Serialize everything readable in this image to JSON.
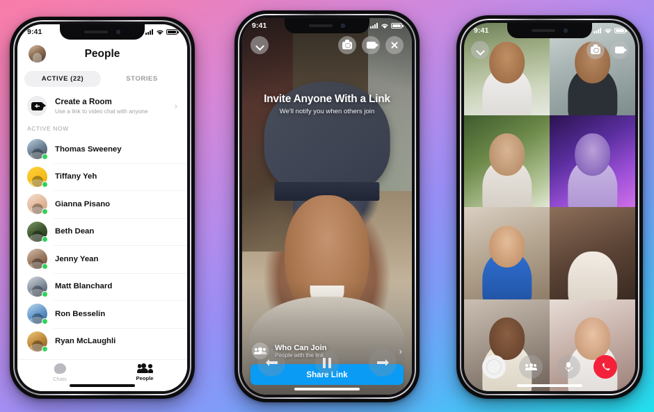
{
  "background": {
    "gradient_colors": [
      "#f97ca8",
      "#d987d6",
      "#9a8ff6",
      "#55b6f8",
      "#22e0ee"
    ]
  },
  "accent": {
    "messenger_blue": "#0a9bf5",
    "active_green": "#31d158",
    "end_call_red": "#f3223a"
  },
  "phone1": {
    "status": {
      "time": "9:41",
      "signal_icon": "cellular-bars-icon",
      "wifi_icon": "wifi-icon",
      "battery_icon": "battery-icon"
    },
    "header": {
      "title": "People",
      "avatar_icon": "profile-avatar"
    },
    "tabs": [
      {
        "label": "ACTIVE (22)",
        "active": true
      },
      {
        "label": "STORIES",
        "active": false
      }
    ],
    "create_room": {
      "icon": "video-room-icon",
      "title": "Create a Room",
      "subtitle": "Use a link to video chat with anyone",
      "chevron": "›"
    },
    "section_label": "ACTIVE NOW",
    "contacts": [
      {
        "name": "Thomas Sweeney",
        "avatar_bg": "linear-gradient(150deg,#bcd0e0,#6d8296 50%,#3b4a58)"
      },
      {
        "name": "Tiffany Yeh",
        "avatar_bg": "linear-gradient(150deg,#ffd23f,#f5bc1c 60%,#e0a812)"
      },
      {
        "name": "Gianna Pisano",
        "avatar_bg": "linear-gradient(150deg,#f6ded0,#e2b89a 55%,#c99a78)"
      },
      {
        "name": "Beth Dean",
        "avatar_bg": "linear-gradient(150deg,#7d9a63,#3e5630 50%,#1d2a16)"
      },
      {
        "name": "Jenny Yean",
        "avatar_bg": "linear-gradient(150deg,#d8c0ae,#9b7a62 50%,#60442f)"
      },
      {
        "name": "Matt Blanchard",
        "avatar_bg": "linear-gradient(150deg,#d6d9dd,#8793a1 50%,#3c4c60)"
      },
      {
        "name": "Ron Besselin",
        "avatar_bg": "linear-gradient(150deg,#bcd9f0,#5f93c6 55%,#2e5d8f)"
      },
      {
        "name": "Ryan McLaughli",
        "avatar_bg": "linear-gradient(150deg,#efc97a,#c08a3e 50%,#7d5420)"
      }
    ],
    "tabbar": [
      {
        "label": "Chats",
        "icon": "chat-bubble-icon",
        "active": false
      },
      {
        "label": "People",
        "icon": "people-icon",
        "active": true
      }
    ]
  },
  "phone2": {
    "status": {
      "time": "9:41",
      "signal_icon": "cellular-bars-icon",
      "wifi_icon": "wifi-icon",
      "battery_icon": "battery-icon"
    },
    "topbar": {
      "minimize_icon": "chevron-down-icon",
      "flip_camera_icon": "flip-camera-icon",
      "video_icon": "video-camera-icon",
      "close_icon": "close-x-icon"
    },
    "invite": {
      "title": "Invite Anyone With a Link",
      "subtitle": "We'll notify you when others join"
    },
    "who_can_join": {
      "icon": "people-group-icon",
      "title": "Who Can Join",
      "subtitle": "People with the link",
      "chevron": "›"
    },
    "share_button": {
      "label": "Share Link"
    },
    "video_controls": {
      "previous_icon": "arrow-left-icon",
      "pause_icon": "pause-icon",
      "next_icon": "arrow-right-icon"
    }
  },
  "phone3": {
    "status": {
      "time": "9:41",
      "signal_icon": "cellular-bars-icon",
      "wifi_icon": "wifi-icon",
      "battery_icon": "battery-icon"
    },
    "topbar": {
      "minimize_icon": "chevron-down-icon",
      "flip_camera_icon": "flip-camera-icon",
      "video_icon": "video-camera-icon"
    },
    "participants": [
      {
        "id": "participant-1",
        "effect": "none",
        "bg": "linear-gradient(170deg,#6d7f58,#9aa97f 30%,#cdd6bd 70%,#e6e8e0)",
        "head": "radial-gradient(ellipse at 50% 38%,#c08f63,#a3714a 70%,#8a5c3b)",
        "body": "linear-gradient(#f0efee,#d9d7d3)"
      },
      {
        "id": "participant-2",
        "effect": "none",
        "bg": "linear-gradient(160deg,#cfd8d6,#a9b5b4 40%,#7d8c8c)",
        "head": "radial-gradient(ellipse at 50% 38%,#b98a63,#9a6c47 70%,#7e5536)",
        "body": "linear-gradient(135deg,#f3f3f3 0 6px,#2b2f36 6px 12px)"
      },
      {
        "id": "participant-3",
        "effect": "bear-ears-filter",
        "bg": "linear-gradient(150deg,#3f5b2e,#6d8a4a 40%,#b6c79a 80%,#e2e7d4)",
        "head": "radial-gradient(ellipse at 50% 40%,#d9b595,#bd9470 70%,#9c7150)",
        "body": "linear-gradient(#ebe7e1,#cfc8bf)"
      },
      {
        "id": "participant-4",
        "effect": "astronaut-filter",
        "bg": "linear-gradient(150deg,#2a1350,#5b2fa0 40%,#9a4fd6 70%,#d06fe8)",
        "head": "radial-gradient(ellipse at 50% 40%,#b9a0d8,#8e6ec0 65%,#6a4aa0)",
        "body": "linear-gradient(#c9b6e4,#a98fd0)"
      },
      {
        "id": "participant-5",
        "effect": "none",
        "bg": "linear-gradient(160deg,#d9cfc2,#b7a894 45%,#8e7d68)",
        "head": "radial-gradient(ellipse at 50% 38%,#e3bd9a,#c99870 70%,#a87a55)",
        "body": "linear-gradient(#2f6fd0,#1f4f9e)"
      },
      {
        "id": "participant-6",
        "effect": "flower-crown-filter",
        "bg": "linear-gradient(160deg,#8d6f5a,#5d4537 50%,#3a2a21)",
        "head": "radial-gradient(ellipse at 50% 40%,#b5seg,#a06f4c 70%,#80553a)",
        "body": "linear-gradient(#f2ece4,#d9cfc2)"
      },
      {
        "id": "participant-7",
        "effect": "glasses-filter",
        "bg": "linear-gradient(160deg,#cbbfb4,#a3968a 45%,#6e625a)",
        "head": "radial-gradient(ellipse at 50% 40%,#8a5f42,#6d4730 70%,#52331f)",
        "body": "linear-gradient(#efeade,#d7d0c0)"
      },
      {
        "id": "participant-8",
        "effect": "none",
        "bg": "linear-gradient(160deg,#e7dcd6,#c8b3ab 45%,#9c8078)",
        "head": "radial-gradient(ellipse at 50% 40%,#e8c3a4,#cd9f7e 70%,#ad7f5e)",
        "body": "linear-gradient(#f4f2f0,#ddd8d4)"
      }
    ],
    "controls": [
      {
        "icon": "camera-shutter-icon",
        "style": "white"
      },
      {
        "icon": "add-people-icon",
        "style": "ghost"
      },
      {
        "icon": "microphone-icon",
        "style": "ghost"
      },
      {
        "icon": "end-call-icon",
        "style": "red"
      }
    ]
  }
}
